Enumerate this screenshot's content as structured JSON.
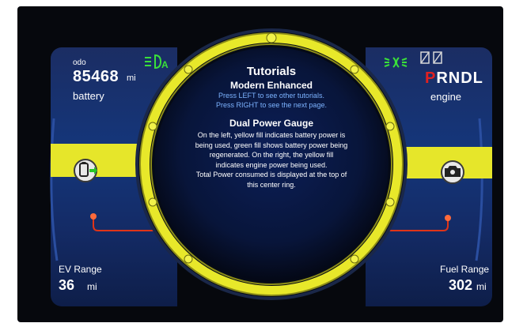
{
  "odometer": {
    "label": "odo",
    "value": "85468",
    "unit": "mi"
  },
  "battery_label": "battery",
  "engine_label": "engine",
  "gear_selector": {
    "current": "P",
    "others": "RNDL"
  },
  "ev_range": {
    "label": "EV Range",
    "value": "36",
    "unit": "mi"
  },
  "fuel_range": {
    "label": "Fuel Range",
    "value": "302",
    "unit": "mi"
  },
  "tutorial": {
    "title": "Tutorials",
    "subtitle": "Modern Enhanced",
    "hint_left": "Press LEFT to see other tutorials.",
    "hint_right": "Press RIGHT to see the next page.",
    "section_title": "Dual Power Gauge",
    "body_lines": [
      "On the left, yellow fill indicates battery power is",
      "being used, green fill shows battery power being",
      "regenerated. On the right, the yellow fill",
      "indicates engine power being used.",
      "Total Power consumed is displayed at the top of",
      "this center ring."
    ]
  },
  "icons": {
    "headlight_left": "headlight-auto-icon",
    "headlight_right": "parking-light-icon",
    "battery_gauge": "battery-charge-icon",
    "engine_gauge": "engine-icon",
    "seatbelt": "seatbelt-icon"
  },
  "colors": {
    "ring_yellow": "#e8e82a",
    "panel_blue": "#15367c",
    "gear_park_red": "#e12020",
    "power_line_red": "#e03418",
    "indicator_green": "#3adf3a",
    "hint_blue": "#7cb3ff"
  }
}
